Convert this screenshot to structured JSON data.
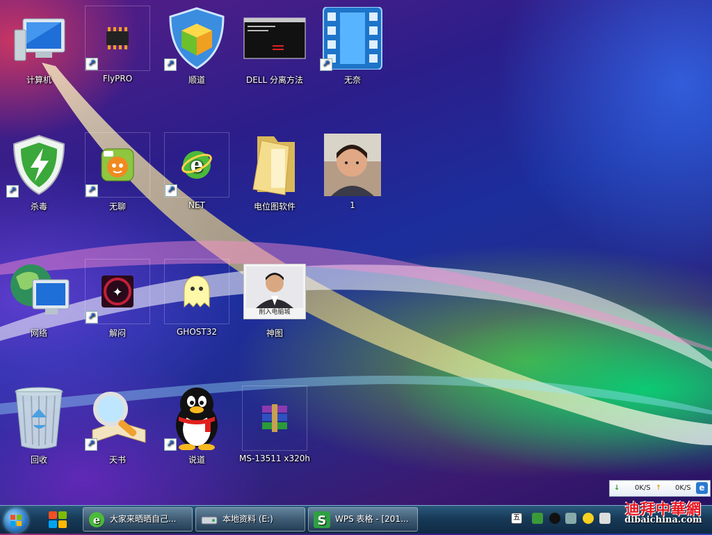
{
  "desktop": {
    "icons": [
      {
        "label": "计算机",
        "icon": "computer-icon"
      },
      {
        "label": "FlyPRO",
        "icon": "chip-icon"
      },
      {
        "label": "顺道",
        "icon": "shield-cube-icon"
      },
      {
        "label": "DELL 分离方法",
        "icon": "terminal-screenshot-icon"
      },
      {
        "label": "无奈",
        "icon": "film-icon"
      },
      {
        "label": "杀毒",
        "icon": "antivirus-shield-icon"
      },
      {
        "label": "无聊",
        "icon": "pps-player-icon"
      },
      {
        "label": "NET",
        "icon": "ie-browser-icon"
      },
      {
        "label": "电位图软件",
        "icon": "folder-icon"
      },
      {
        "label": "1",
        "icon": "photo-child-icon"
      },
      {
        "label": "网络",
        "icon": "network-globe-icon"
      },
      {
        "label": "解闷",
        "icon": "xingyun-icon"
      },
      {
        "label": "GHOST32",
        "icon": "ghost-icon"
      },
      {
        "label": "神图",
        "icon": "photo-person-icon",
        "caption": "削入电脑城"
      },
      {
        "label": "回收",
        "icon": "recycle-bin-icon"
      },
      {
        "label": "天书",
        "icon": "magnifier-book-icon"
      },
      {
        "label": "说道",
        "icon": "qq-penguin-icon"
      },
      {
        "label": "MS-13511 x320h",
        "icon": "winrar-icon"
      }
    ]
  },
  "taskbar": {
    "tasks": [
      {
        "label": "大家来晒晒自己...",
        "icon": "ie-browser-icon"
      },
      {
        "label": "本地资料 (E:)",
        "icon": "drive-icon"
      },
      {
        "label": "WPS 表格 - [201...",
        "icon": "wps-spreadsheet-icon"
      }
    ],
    "tray_ime": "五"
  },
  "net_widget": {
    "download": "0K/S",
    "upload": "0K/S"
  },
  "watermark": {
    "cn": "迪拜中華網",
    "en": "dibaichina.com"
  }
}
